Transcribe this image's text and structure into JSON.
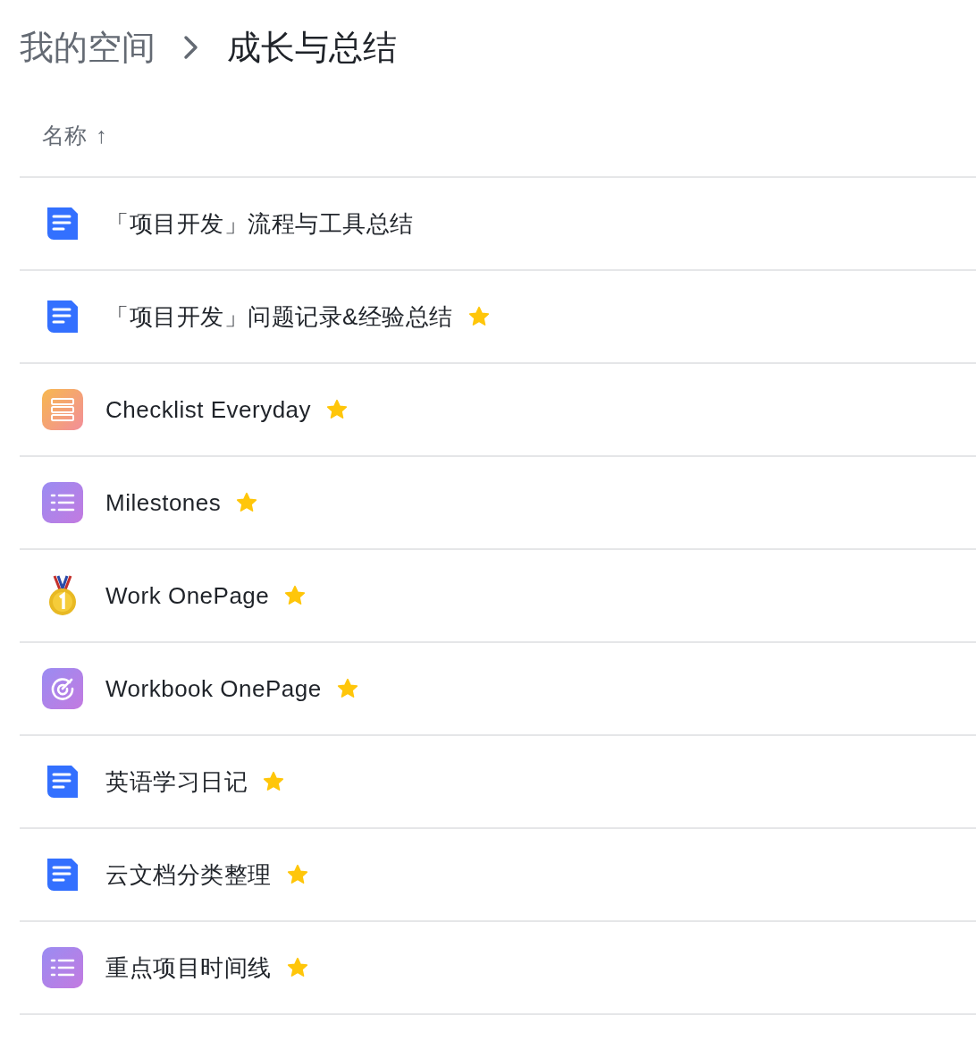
{
  "breadcrumb": [
    {
      "label": "我的空间",
      "current": false
    },
    {
      "label": "成长与总结",
      "current": true
    }
  ],
  "table": {
    "columns": [
      {
        "label": "名称",
        "sort_indicator": "↑"
      }
    ],
    "rows": [
      {
        "kind": "doc",
        "name": "「项目开发」流程与工具总结",
        "starred": false
      },
      {
        "kind": "doc",
        "name": "「项目开发」问题记录&经验总结",
        "starred": true
      },
      {
        "kind": "sheet",
        "name": "Checklist Everyday",
        "starred": true
      },
      {
        "kind": "list",
        "name": "Milestones",
        "starred": true
      },
      {
        "kind": "medal",
        "name": "Work OnePage",
        "starred": true
      },
      {
        "kind": "target",
        "name": "Workbook OnePage",
        "starred": true
      },
      {
        "kind": "doc",
        "name": "英语学习日记",
        "starred": true
      },
      {
        "kind": "doc",
        "name": "云文档分类整理",
        "starred": true
      },
      {
        "kind": "list",
        "name": "重点项目时间线",
        "starred": true
      }
    ]
  }
}
